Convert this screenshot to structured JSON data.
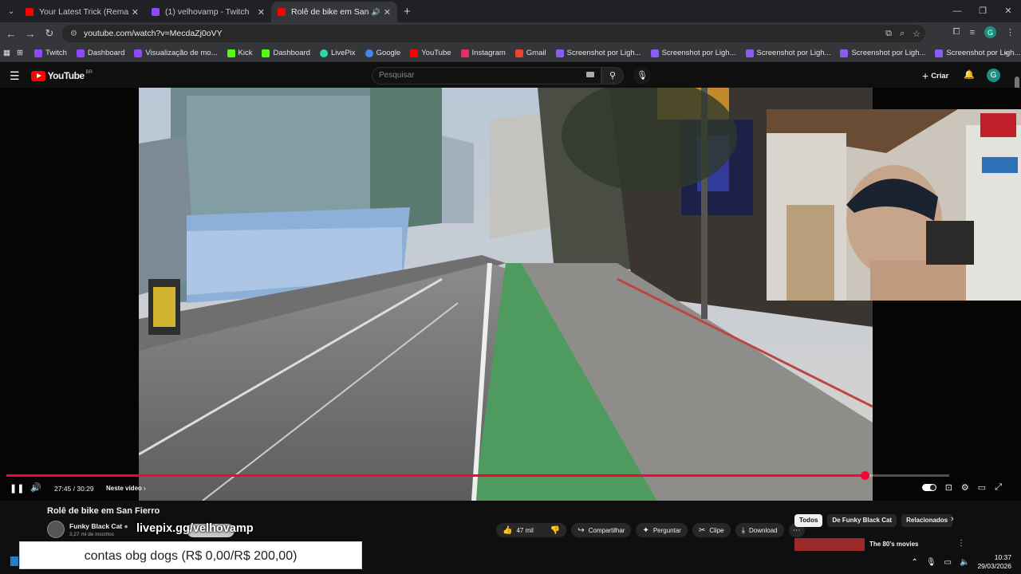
{
  "browser": {
    "tabs": [
      {
        "title": "Your Latest Trick (Remastered",
        "favicon_color": "#ff0000",
        "icon": "youtube-icon"
      },
      {
        "title": "(1) velhovamp - Twitch",
        "favicon_color": "#9146ff",
        "icon": "twitch-icon"
      },
      {
        "title": "Rolê de bike em San Fierro",
        "favicon_color": "#ff0000",
        "icon": "youtube-icon",
        "active": true,
        "audio": true
      }
    ],
    "new_tab": "+",
    "url": "youtube.com/watch?v=MecdaZj0oVY",
    "bookmarks": [
      {
        "label": "Twitch",
        "color": "#9146ff"
      },
      {
        "label": "Dashboard",
        "color": "#9146ff"
      },
      {
        "label": "Visualização de mo...",
        "color": "#9146ff"
      },
      {
        "label": "Kick",
        "color": "#53fc18"
      },
      {
        "label": "Dashboard",
        "color": "#53fc18"
      },
      {
        "label": "LivePix",
        "color": "#2fd8a8"
      },
      {
        "label": "Google",
        "color": "#4285f4"
      },
      {
        "label": "YouTube",
        "color": "#ff0000"
      },
      {
        "label": "Instagram",
        "color": "#e1306c"
      },
      {
        "label": "Gmail",
        "color": "#ea4335"
      },
      {
        "label": "Screenshot por Ligh...",
        "color": "#8a5cf6"
      },
      {
        "label": "Screenshot por Ligh...",
        "color": "#8a5cf6"
      },
      {
        "label": "Screenshot por Ligh...",
        "color": "#8a5cf6"
      },
      {
        "label": "Screenshot por Ligh...",
        "color": "#8a5cf6"
      },
      {
        "label": "Screenshot por Ligh...",
        "color": "#8a5cf6"
      }
    ],
    "profile_initial": "G"
  },
  "youtube": {
    "logo_text": "YouTube",
    "logo_country": "BR",
    "search_placeholder": "Pesquisar",
    "create_label": "Criar",
    "avatar_initial": "G"
  },
  "player": {
    "time_current": "27:45",
    "time_total": "30:29",
    "time_display": "27:45 / 30:29",
    "progress_fraction": 0.91,
    "chapter_label": "Neste vídeo"
  },
  "video": {
    "title": "Rolê de bike em San Fierro",
    "channel_name": "Funky Black Cat",
    "subscribers": "3,27 mi de inscritos",
    "overlay_text": "livepix.gg/velhovamp",
    "likes": "47 mil",
    "share_label": "Compartilhar",
    "ask_label": "Perguntar",
    "clip_label": "Clipe",
    "download_label": "Download"
  },
  "sidebar": {
    "chips": [
      "Todos",
      "De Funky Black Cat",
      "Relacionados"
    ],
    "recommendation_title": "The 80's movies"
  },
  "donation": {
    "text": "contas obg dogs (R$ 0,00/R$ 200,00)"
  },
  "taskbar": {
    "time": "10:37",
    "date": "29/03/2026"
  }
}
